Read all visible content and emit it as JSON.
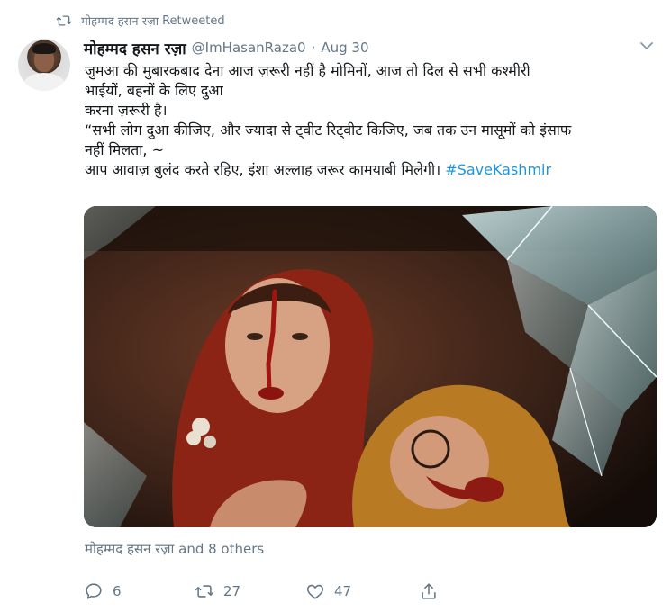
{
  "retweet_banner": {
    "icon": "retweet-icon",
    "user": "मोहम्मद हसन रज़ा",
    "label": "Retweeted"
  },
  "tweet": {
    "author_name": "मोहम्मद हसन रज़ा",
    "handle": "@ImHasanRaza0",
    "separator": "·",
    "date": "Aug 30",
    "text_lines": [
      "जुमआ की मुबारकबाद देना आज ज़रूरी नहीं है मोमिनों, आज तो दिल से सभी कश्मीरी",
      "भाईयों, बहनों के लिए दुआ",
      "करना ज़रूरी है।",
      "“सभी लोग दुआ कीजिए, और ज्यादा से ट्वीट रिट्वीट किजिए, जब तक उन मासूमों को इंसाफ",
      "नहीं मिलता, ~",
      "आप आवाज़ बुलंद करते रहिए, इंशा अल्लाह जरूर कामयाबी मिलेगी। "
    ],
    "hashtag": "#SaveKashmir",
    "media_icon": "photo-media",
    "social_proof": "मोहम्मद हसन रज़ा and 8 others",
    "actions": {
      "reply_count": "6",
      "retweet_count": "27",
      "like_count": "47"
    }
  },
  "colors": {
    "text_primary": "#14171a",
    "text_secondary": "#657786",
    "link": "#1b95e0"
  },
  "icons": [
    "retweet-icon",
    "chevron-down-icon",
    "reply-icon",
    "retweet-icon",
    "like-icon",
    "share-icon"
  ]
}
